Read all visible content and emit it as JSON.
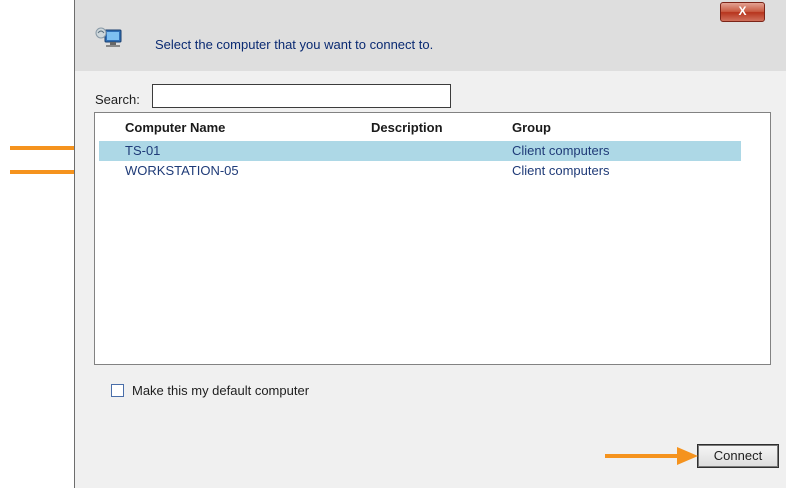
{
  "dialog": {
    "close_label": "X",
    "header": {
      "title": "Select the computer that you want to connect to.",
      "icon": "network-computer-icon"
    },
    "search": {
      "label": "Search:",
      "value": ""
    },
    "list": {
      "columns": [
        "Computer Name",
        "Description",
        "Group"
      ],
      "rows": [
        {
          "name": "TS-01",
          "description": "",
          "group": "Client computers",
          "selected": true
        },
        {
          "name": "WORKSTATION-05",
          "description": "",
          "group": "Client computers",
          "selected": false
        }
      ]
    },
    "default_checkbox": {
      "label": "Make this my default computer",
      "checked": false
    },
    "connect_label": "Connect"
  },
  "annotations": {
    "arrow_color": "#f5931e"
  },
  "colors": {
    "selection": "#add8e6",
    "header_bg": "#dedede",
    "title_text": "#0a2a72",
    "row_text": "#1f3b78"
  }
}
